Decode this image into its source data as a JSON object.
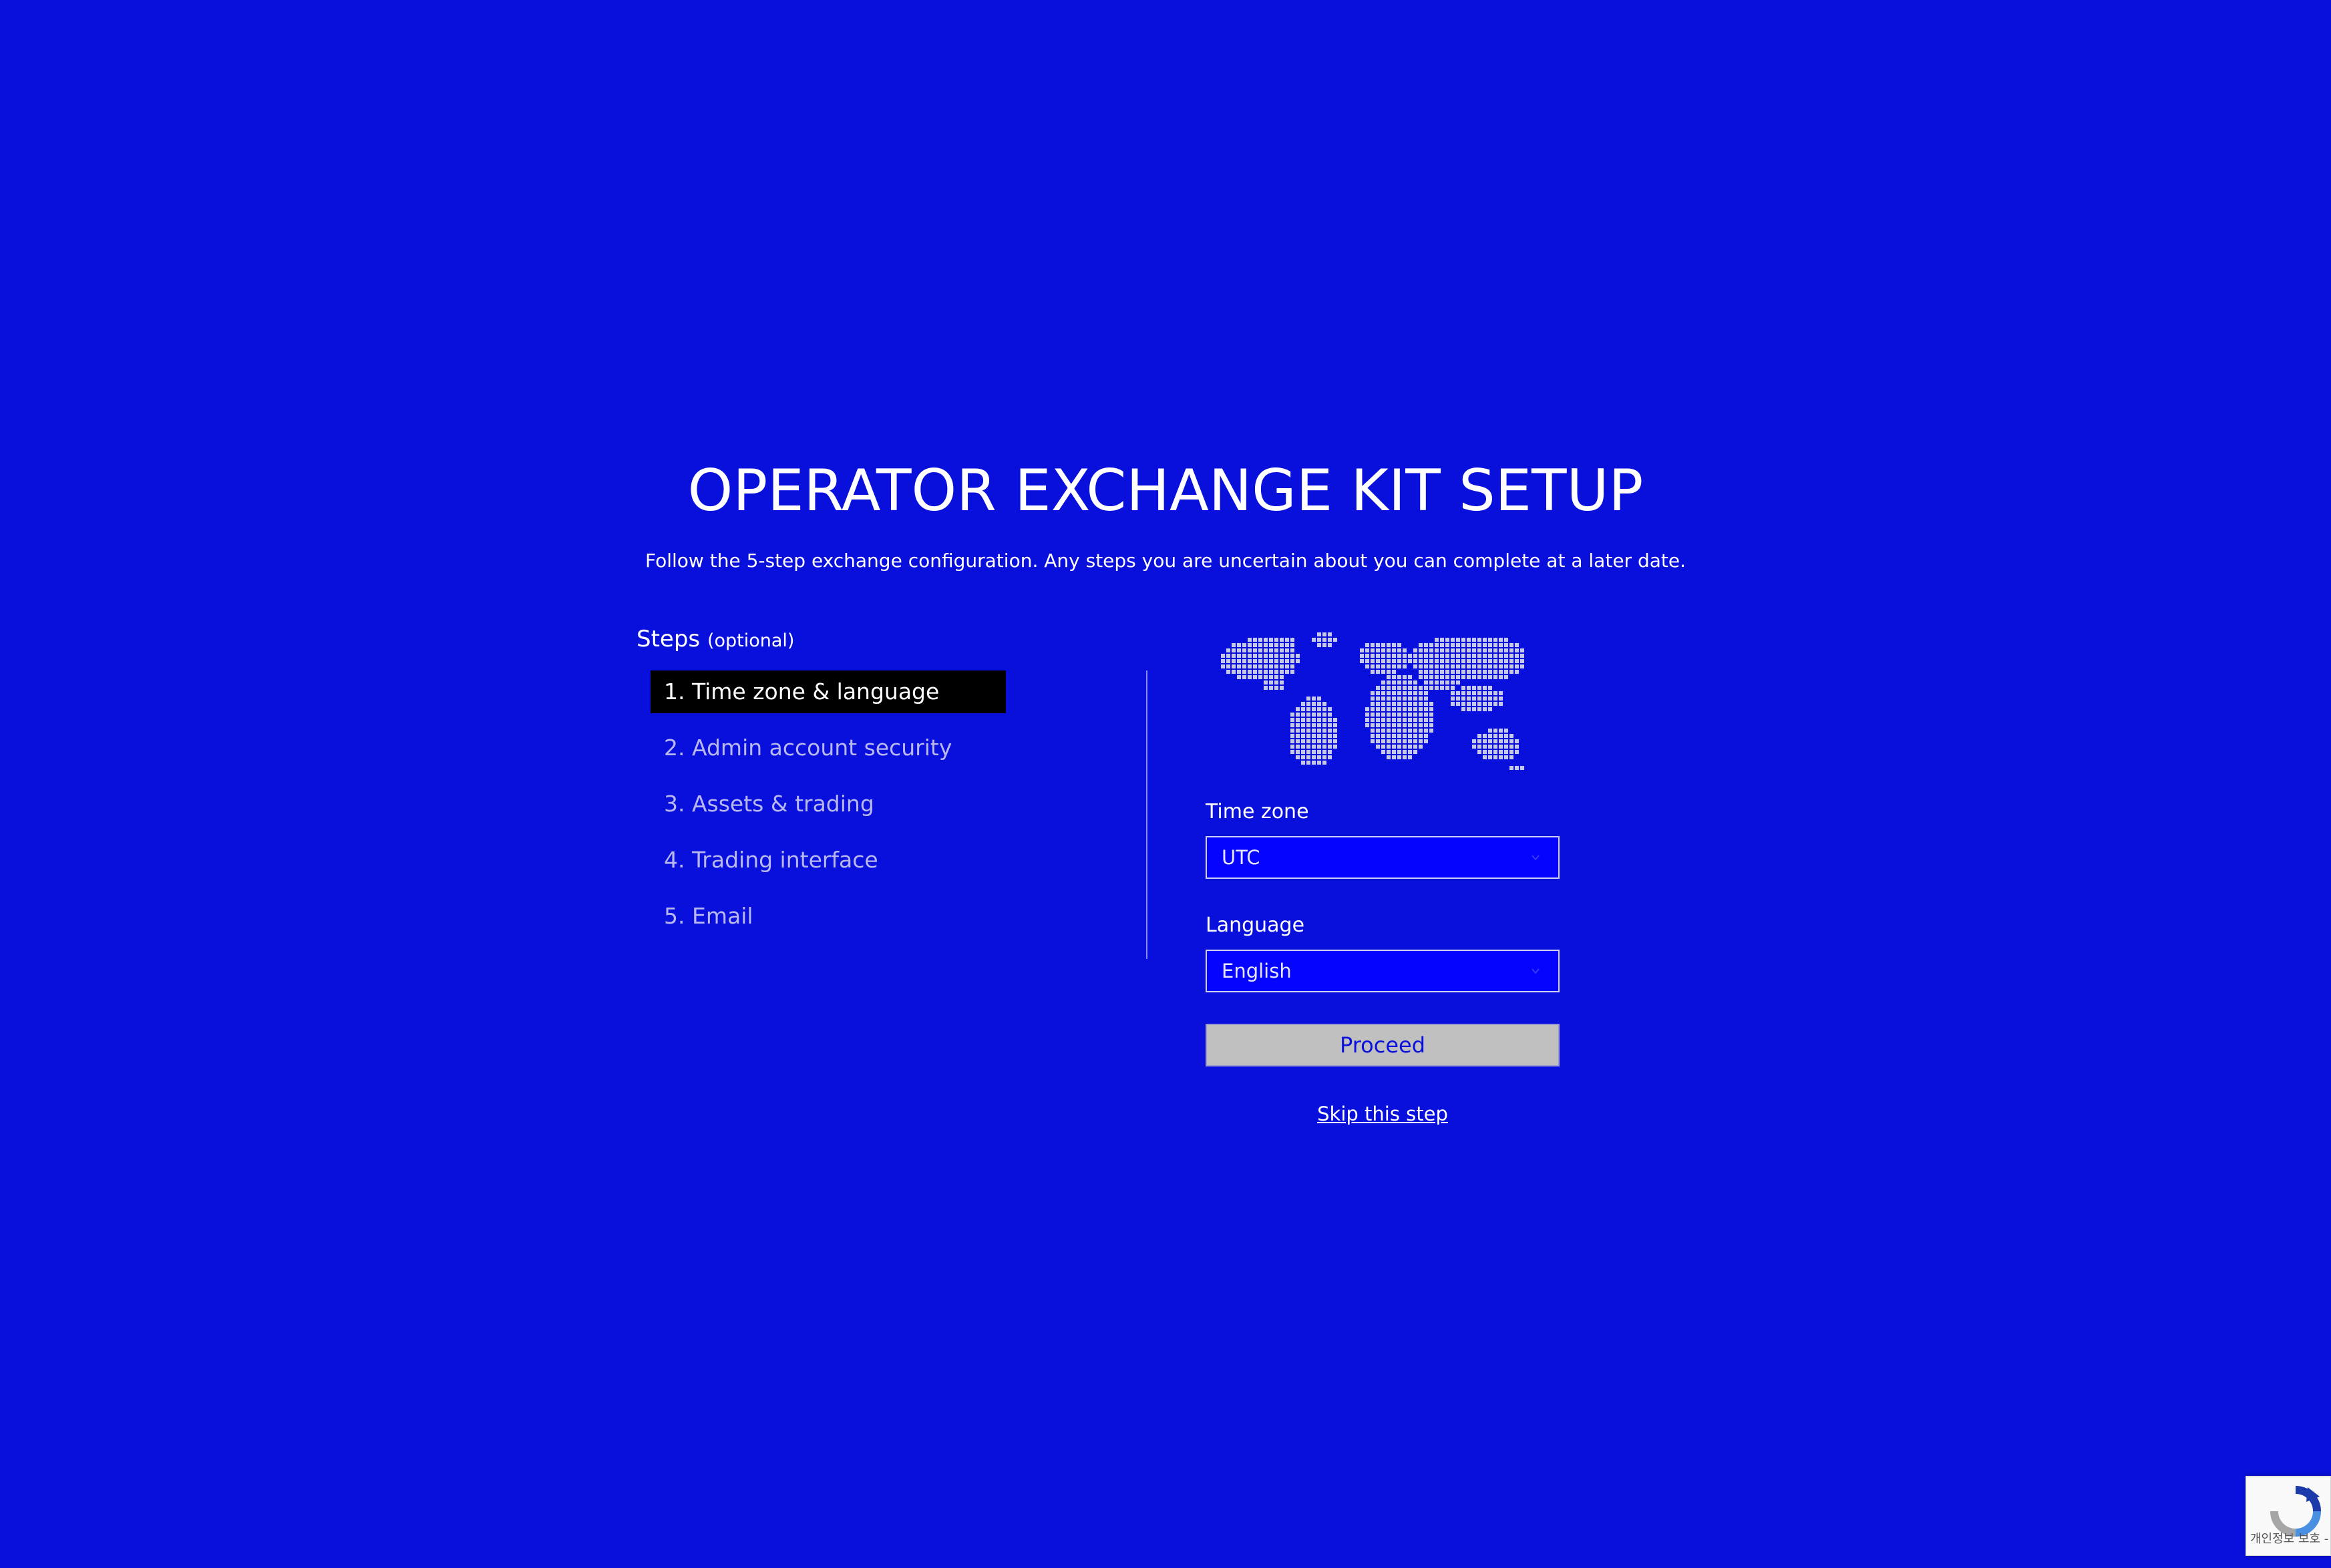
{
  "header": {
    "title": "OPERATOR EXCHANGE KIT SETUP",
    "subtitle": "Follow the 5-step exchange configuration. Any steps you are uncertain about you can complete at a later date."
  },
  "steps": {
    "heading": "Steps",
    "heading_note": "(optional)",
    "items": [
      {
        "label": "1. Time zone & language",
        "active": true
      },
      {
        "label": "2. Admin account security",
        "active": false
      },
      {
        "label": "3. Assets & trading",
        "active": false
      },
      {
        "label": "4. Trading interface",
        "active": false
      },
      {
        "label": "5. Email",
        "active": false
      }
    ]
  },
  "form": {
    "map_icon": "world-map-icon",
    "timezone_label": "Time zone",
    "timezone_value": "UTC",
    "language_label": "Language",
    "language_value": "English",
    "proceed_label": "Proceed",
    "skip_label": "Skip this step"
  },
  "recaptcha": {
    "icon": "recaptcha-icon",
    "privacy_text": "개인정보 보호 - 약관"
  },
  "colors": {
    "background": "#0a10dc",
    "active_step": "#000000",
    "inactive_step_text": "#b8b8ee",
    "select_background": "#0505ff",
    "proceed_background": "#c0c0c0",
    "map_dots": "#c8c8e8"
  }
}
